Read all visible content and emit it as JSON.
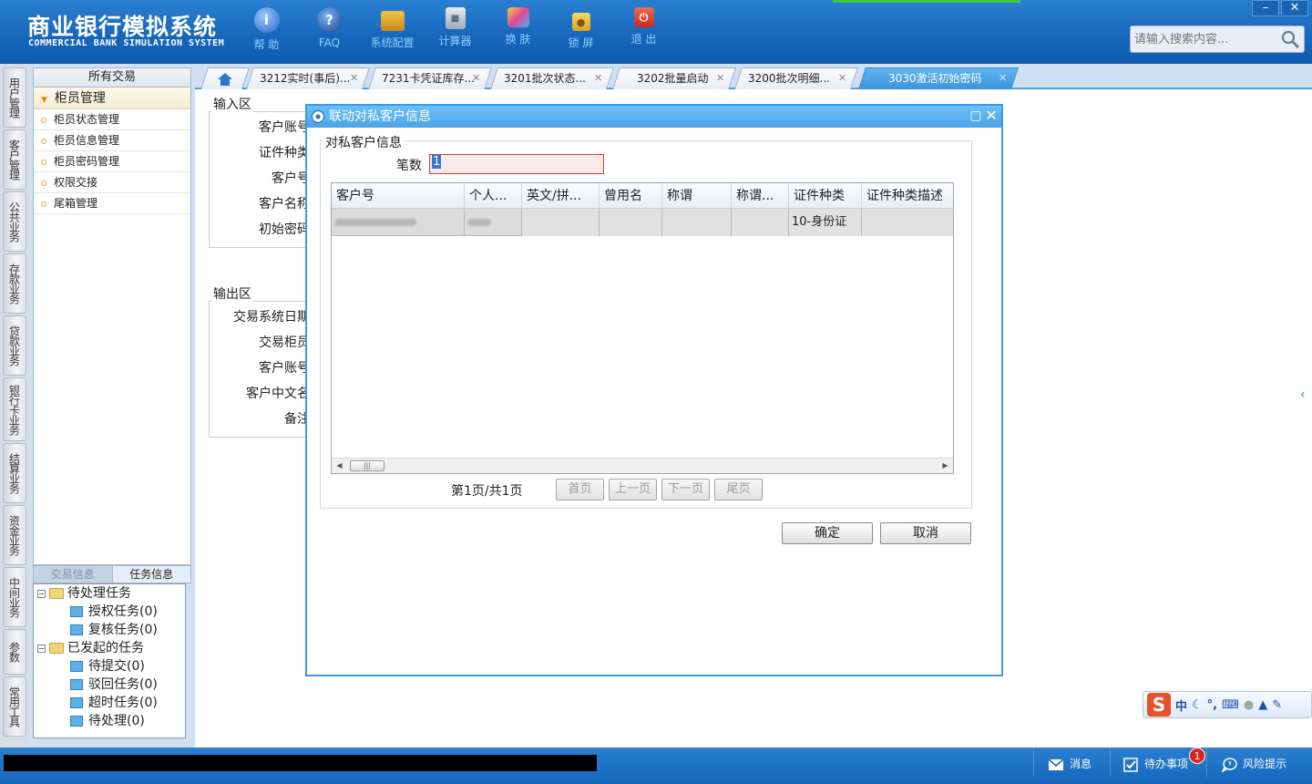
{
  "app": {
    "title_cn": "商业银行模拟系统",
    "title_en": "COMMERCIAL BANK SIMULATION SYSTEM"
  },
  "topnav": [
    {
      "label": "帮 助",
      "icon": "info-icon"
    },
    {
      "label": "FAQ",
      "icon": "question-icon"
    },
    {
      "label": "系统配置",
      "icon": "toolbox-icon"
    },
    {
      "label": "计算器",
      "icon": "calculator-icon"
    },
    {
      "label": "换 肤",
      "icon": "tshirt-icon"
    },
    {
      "label": "锁 屏",
      "icon": "lock-icon"
    },
    {
      "label": "退 出",
      "icon": "power-icon"
    }
  ],
  "window": {
    "minimize": "–",
    "close": "✕"
  },
  "search": {
    "placeholder": "请输入搜索内容..."
  },
  "side_categories": [
    "用户管理",
    "客户管理",
    "公共业务",
    "存款业务",
    "贷款业务",
    "银行卡业务",
    "结算业务",
    "资金业务",
    "中间业务",
    "参数",
    "常用工具"
  ],
  "left_panel": {
    "header": "所有交易",
    "group": "柜员管理",
    "items": [
      "柜员状态管理",
      "柜员信息管理",
      "柜员密码管理",
      "权限交接",
      "尾箱管理"
    ],
    "tabs": [
      "交易信息",
      "任务信息"
    ],
    "tree": {
      "pending": "待处理任务",
      "pending_children": [
        "授权任务(0)",
        "复核任务(0)"
      ],
      "initiated": "已发起的任务",
      "initiated_children": [
        "待提交(0)",
        "驳回任务(0)",
        "超时任务(0)",
        "待处理(0)"
      ]
    }
  },
  "tabs": [
    {
      "label": "3212实时(事后)..."
    },
    {
      "label": "7231卡凭证库存..."
    },
    {
      "label": "3201批次状态..."
    },
    {
      "label": "3202批量启动"
    },
    {
      "label": "3200批次明细..."
    },
    {
      "label": "3030激活初始密码"
    }
  ],
  "form": {
    "input_area": "输入区",
    "input_labels": [
      "客户账号",
      "证件种类",
      "客户号",
      "客户名称",
      "初始密码"
    ],
    "output_area": "输出区",
    "output_labels": [
      "交易系统日期",
      "交易柜员",
      "客户账号",
      "客户中文名",
      "备注"
    ]
  },
  "dialog": {
    "title": "联动对私客户信息",
    "section": "对私客户信息",
    "count_label": "笔数",
    "count_value": "1",
    "columns": [
      "客户号",
      "个人...",
      "英文/拼...",
      "曾用名",
      "称谓",
      "称谓...",
      "证件种类",
      "证件种类描述"
    ],
    "row": {
      "id_type": "10-身份证"
    },
    "pager": {
      "text": "第1页/共1页",
      "first": "首页",
      "prev": "上一页",
      "next": "下一页",
      "last": "尾页"
    },
    "ok": "确定",
    "cancel": "取消"
  },
  "ime": {
    "lang": "中"
  },
  "statusbar": {
    "messages": "消息",
    "todo": "待办事项",
    "todo_count": "1",
    "risk": "风险提示"
  },
  "colors": {
    "header_blue": "#1566bb",
    "active_tab": "#3a94de",
    "dialog_border": "#3a9ae8",
    "badge_red": "#d8261e"
  }
}
